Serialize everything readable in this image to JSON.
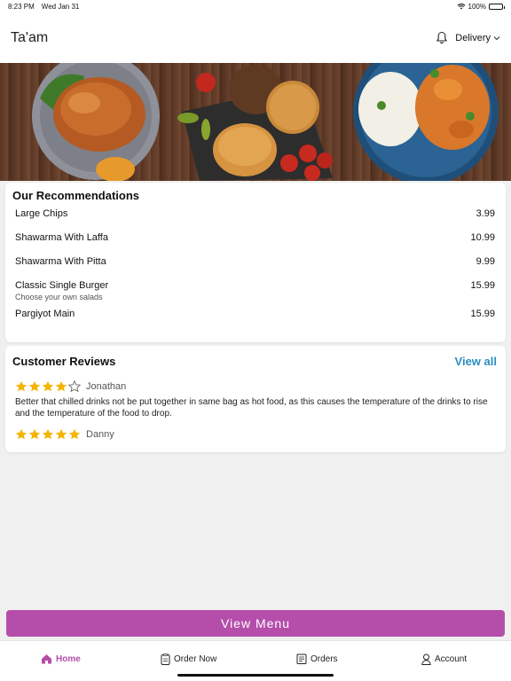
{
  "status": {
    "time": "8:23 PM",
    "date": "Wed Jan 31",
    "battery": "100%",
    "battery_level": 1.0
  },
  "header": {
    "title": "Ta'am",
    "mode": "Delivery"
  },
  "recommendations": {
    "title": "Our Recommendations",
    "items": [
      {
        "name": "Large Chips",
        "price": "3.99"
      },
      {
        "name": "Shawarma With Laffa",
        "price": "10.99"
      },
      {
        "name": "Shawarma With Pitta",
        "price": "9.99"
      },
      {
        "name": "Classic Single Burger",
        "subtitle": "Choose your own salads",
        "price": "15.99"
      },
      {
        "name": "Pargiyot Main",
        "price": "15.99"
      }
    ]
  },
  "reviews": {
    "title": "Customer Reviews",
    "view_all": "View all",
    "items": [
      {
        "author": "Jonathan",
        "rating": 4,
        "text": "Better that chilled drinks not be put together in same bag as hot food, as this causes the temperature of the drinks to rise and the temperature of the food to drop."
      },
      {
        "author": "Danny",
        "rating": 5,
        "text": ""
      }
    ]
  },
  "view_menu": "View Menu",
  "tabs": {
    "home": "Home",
    "order_now": "Order Now",
    "orders": "Orders",
    "account": "Account"
  },
  "colors": {
    "accent": "#b54eab",
    "link": "#2a8fbf",
    "star": "#f5b400"
  }
}
